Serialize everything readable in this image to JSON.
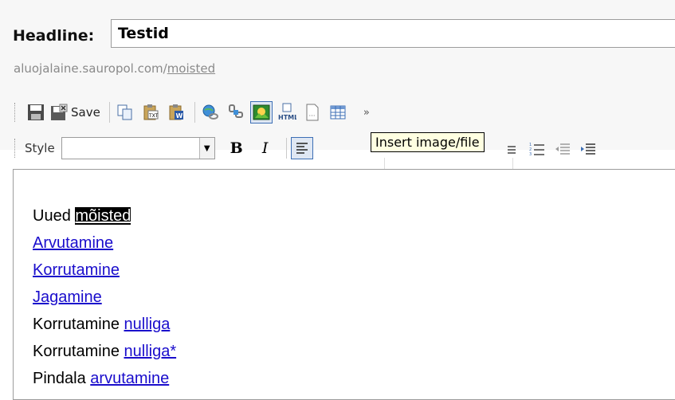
{
  "headline": {
    "label": "Headline:",
    "value": "Testid"
  },
  "url": {
    "base": "aluojalaine.sauropol.com/",
    "slug": "moisted"
  },
  "toolbar": {
    "save_label": "Save",
    "more": "»",
    "style_label": "Style",
    "style_value": "",
    "bold": "B",
    "italic": "I",
    "html": "HTML",
    "tooltip": "Insert image/file"
  },
  "content": {
    "lines": [
      {
        "text": "Uued ",
        "selected": "mõisted"
      },
      {
        "link": "Arvutamine"
      },
      {
        "link": "Korrutamine"
      },
      {
        "link": "Jagamine"
      },
      {
        "text": "Korrutamine ",
        "link": "nulliga"
      },
      {
        "text": "Korrutamine ",
        "link": "nulliga*"
      },
      {
        "text": "Pindala ",
        "link": "arvutamine"
      }
    ]
  },
  "colors": {
    "link": "#1a0dcc",
    "active_border": "#3d6fb5",
    "tooltip_bg": "#ffffe1"
  }
}
